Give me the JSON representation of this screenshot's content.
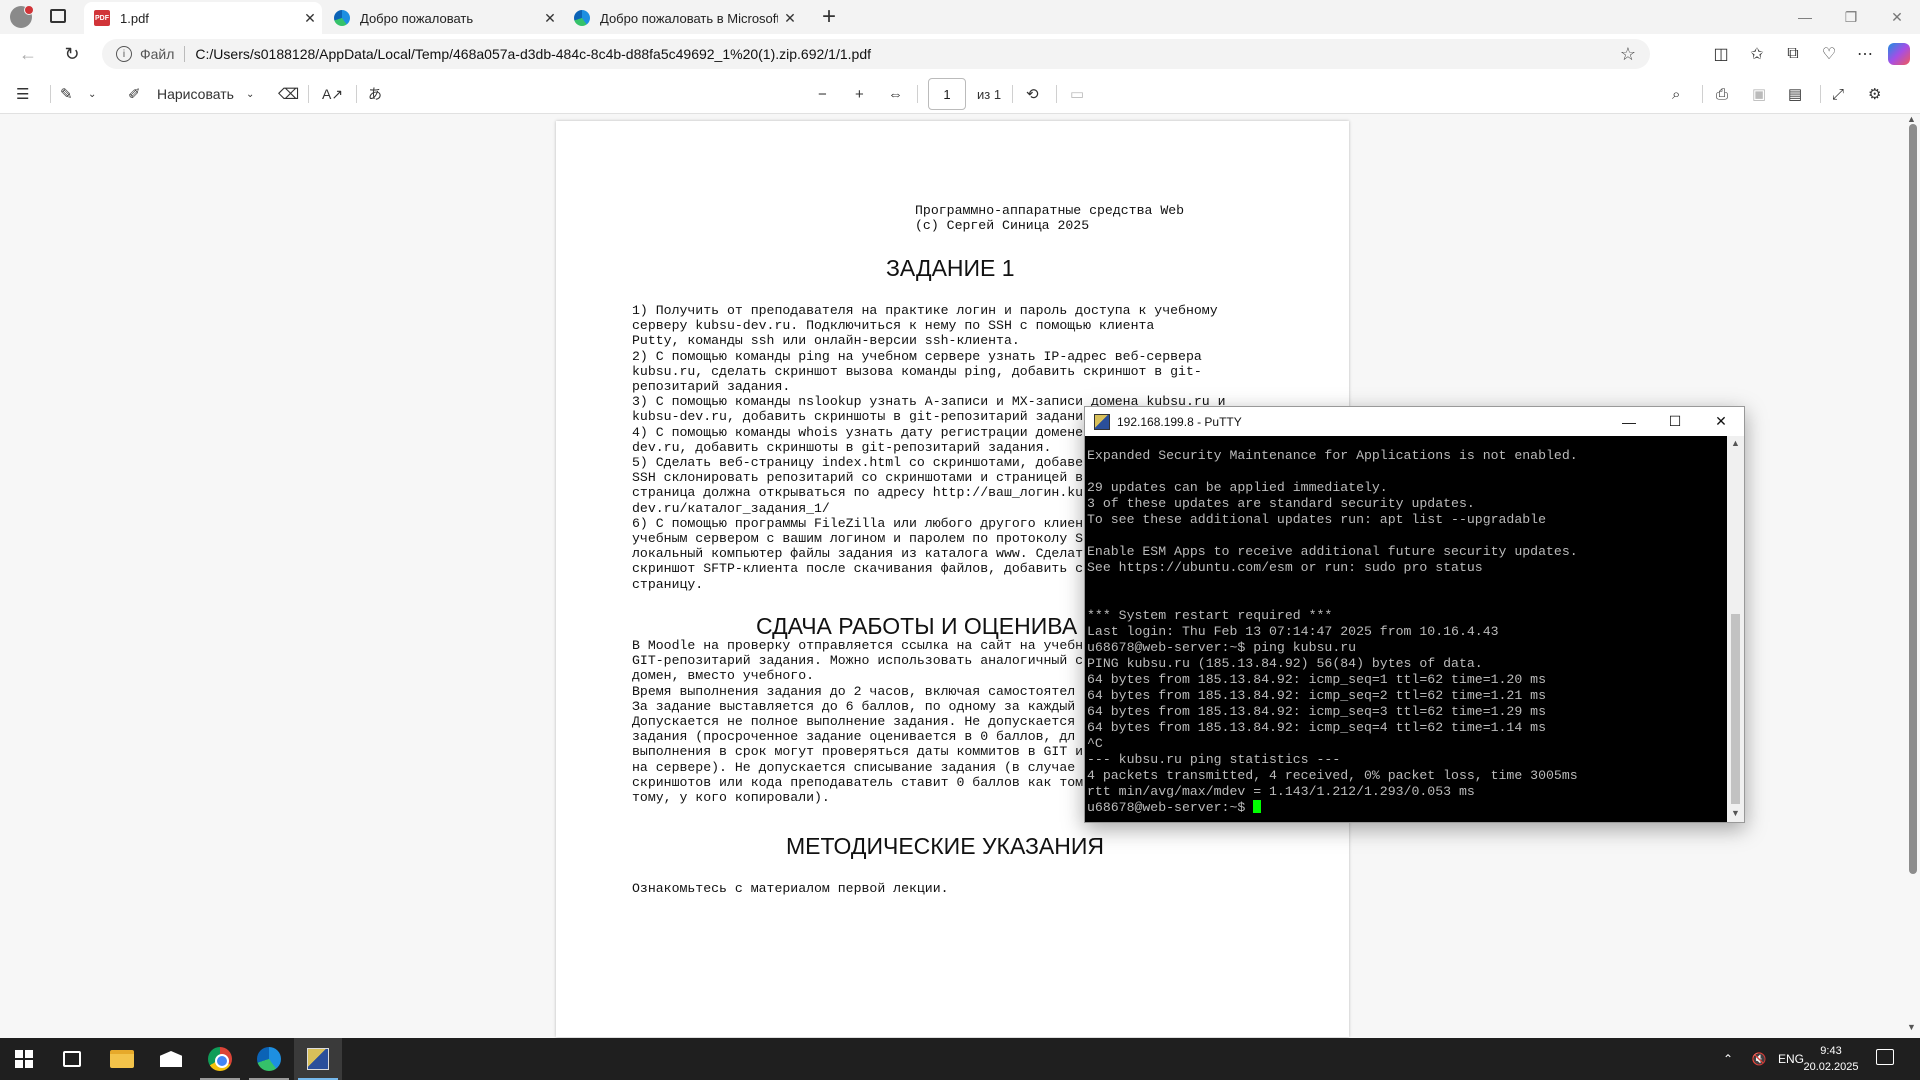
{
  "browser": {
    "tabs": [
      {
        "label": "1.pdf",
        "favicon": "pdf-icon",
        "active": true
      },
      {
        "label": "Добро пожаловать",
        "favicon": "edge-icon",
        "active": false
      },
      {
        "label": "Добро пожаловать в Microsoft E",
        "favicon": "edge-icon",
        "active": false
      }
    ],
    "address": {
      "scheme_label": "Файл",
      "url": "C:/Users/s0188128/AppData/Local/Temp/468a057a-d3db-484c-8c4b-d88fa5c49692_1%20(1).zip.692/1/1.pdf"
    }
  },
  "pdf_toolbar": {
    "draw_label": "Нарисовать",
    "page_value": "1",
    "page_of": "из 1"
  },
  "document": {
    "header_lines": [
      "Программно-аппаратные средства Web",
      "(с) Сергей Синица 2025"
    ],
    "section1_title": "ЗАДАНИЕ 1",
    "section1_lines": [
      "1) Получить от преподавателя на практике логин и пароль доступа к учебному",
      "серверу kubsu-dev.ru. Подключиться к нему по SSH с помощью клиента",
      "Putty, команды ssh или онлайн-версии ssh-клиента.",
      "2) С помощью команды ping на учебном сервере узнать IP-адрес веб-сервера",
      "kubsu.ru, сделать скриншот вызова команды ping, добавить скриншот в git-",
      "репозитарий задания.",
      "3) С помощью команды nslookup узнать A-записи и MX-записи домена kubsu.ru и",
      "kubsu-dev.ru, добавить скриншоты в git-репозитарий задани",
      "4) С помощью команды whois узнать дату регистрации домене",
      "dev.ru, добавить скриншоты в git-репозитарий задания.",
      "5) Сделать веб-страницу index.html со скриншотами, добаве",
      "SSH склонировать репозитарий со скриншотами и страницей в",
      "страница должна открываться по адресу http://ваш_логин.ku",
      "dev.ru/каталог_задания_1/",
      "6) С помощью программы FileZilla или любого другого клиен",
      "учебным сервером с вашим логином и паролем по протоколу S",
      "локальный компьютер файлы задания из каталога www. Сделат",
      "скриншот SFTP-клиента после скачивания файлов, добавить с",
      "страницу."
    ],
    "section2_title": "СДАЧА РАБОТЫ И ОЦЕНИВА",
    "section2_lines": [
      "В Moodle на проверку отправляется ссылка на сайт на учебн",
      "GIT-репозитарий задания. Можно использовать аналогичный с",
      "домен, вместо учебного.",
      "Время выполнения задания до 2 часов, включая самостоятел",
      "За задание выставляется до 6 баллов, по одному за каждый",
      "Допускается не полное выполнение задания. Не допускается",
      "задания (просроченное задание оценивается в 0 баллов, дл",
      "выполнения в срок могут проверяться даты коммитов в GIT и",
      "на сервере). Не допускается списывание задания (в случае",
      "скриншотов или кода преподаватель ставит 0 баллов как том",
      "тому, у кого копировали)."
    ],
    "section3_title": "МЕТОДИЧЕСКИЕ УКАЗАНИЯ",
    "section3_lines": [
      "Ознакомьтесь с материалом первой лекции."
    ]
  },
  "putty": {
    "title": "192.168.199.8 - PuTTY",
    "lines": [
      "Expanded Security Maintenance for Applications is not enabled.",
      "",
      "29 updates can be applied immediately.",
      "3 of these updates are standard security updates.",
      "To see these additional updates run: apt list --upgradable",
      "",
      "Enable ESM Apps to receive additional future security updates.",
      "See https://ubuntu.com/esm or run: sudo pro status",
      "",
      "",
      "*** System restart required ***",
      "Last login: Thu Feb 13 07:14:47 2025 from 10.16.4.43",
      "u68678@web-server:~$ ping kubsu.ru",
      "PING kubsu.ru (185.13.84.92) 56(84) bytes of data.",
      "64 bytes from 185.13.84.92: icmp_seq=1 ttl=62 time=1.20 ms",
      "64 bytes from 185.13.84.92: icmp_seq=2 ttl=62 time=1.21 ms",
      "64 bytes from 185.13.84.92: icmp_seq=3 ttl=62 time=1.29 ms",
      "64 bytes from 185.13.84.92: icmp_seq=4 ttl=62 time=1.14 ms",
      "^C",
      "--- kubsu.ru ping statistics ---",
      "4 packets transmitted, 4 received, 0% packet loss, time 3005ms",
      "rtt min/avg/max/mdev = 1.143/1.212/1.293/0.053 ms"
    ],
    "prompt": "u68678@web-server:~$ ",
    "cursor_color": "#00ff00"
  },
  "taskbar": {
    "apps": [
      "start-icon",
      "task-view-icon",
      "file-explorer-icon",
      "mail-icon",
      "chrome-icon",
      "edge-icon",
      "putty-icon"
    ],
    "lang": "ENG",
    "time": "9:43",
    "date": "20.02.2025"
  },
  "colors": {
    "terminal_bg": "#000000",
    "terminal_fg": "#bbbbbb",
    "taskbar_bg": "#1f1f1f"
  }
}
